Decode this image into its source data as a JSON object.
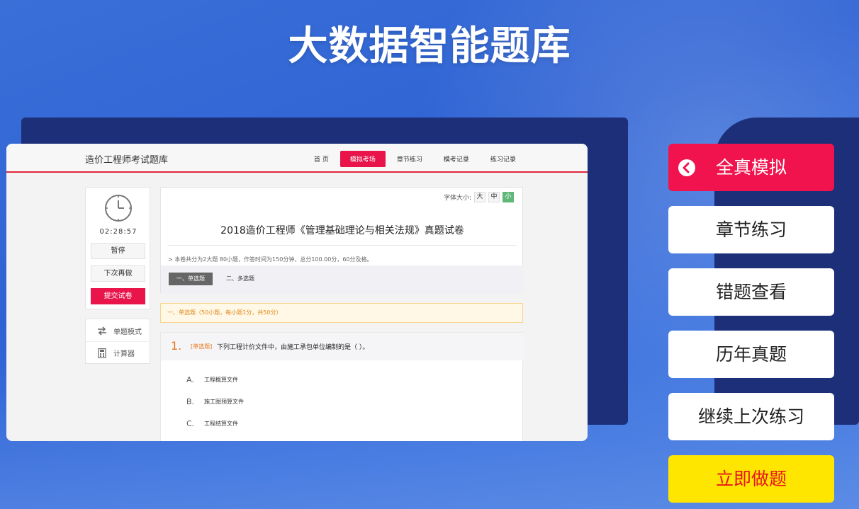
{
  "hero": {
    "title": "大数据智能题库"
  },
  "app": {
    "brand": "造价工程师考试题库",
    "nav": [
      {
        "label": "首 页"
      },
      {
        "label": "模拟考场"
      },
      {
        "label": "章节练习"
      },
      {
        "label": "模考记录"
      },
      {
        "label": "练习记录"
      }
    ],
    "timer": "02:28:57",
    "side_buttons": {
      "pause": "暂停",
      "later": "下次再做",
      "submit": "提交试卷"
    },
    "tools": {
      "single_mode": "单题模式",
      "calculator": "计算器"
    },
    "font_size": {
      "label": "字体大小:",
      "large": "大",
      "medium": "中",
      "small": "小"
    },
    "exam": {
      "title": "2018造价工程师《管理基础理论与相关法规》真题试卷",
      "info": "> 本卷共分为2大题 80小题，作答时间为150分钟，总分100.00分，60分及格。",
      "tabs": [
        "一、单选题",
        "二、多选题"
      ]
    },
    "notice": "一、单选题（50小题，每小题1分，共50分）",
    "question": {
      "number": "1.",
      "type": "[单选题]",
      "text": "下列工程计价文件中，由施工承包单位编制的是（ ）。",
      "options": [
        {
          "letter": "A.",
          "text": "工程概算文件"
        },
        {
          "letter": "B.",
          "text": "施工图预算文件"
        },
        {
          "letter": "C.",
          "text": "工程结算文件"
        }
      ]
    }
  },
  "menu": {
    "full_mock": "全真模拟",
    "chapter": "章节练习",
    "wrong": "错题查看",
    "past": "历年真题",
    "continue": "继续上次练习",
    "start": "立即做题"
  },
  "colors": {
    "accent_red": "#f0134d",
    "cta_yellow": "#ffe600",
    "dark_panel": "#1c2f78"
  }
}
